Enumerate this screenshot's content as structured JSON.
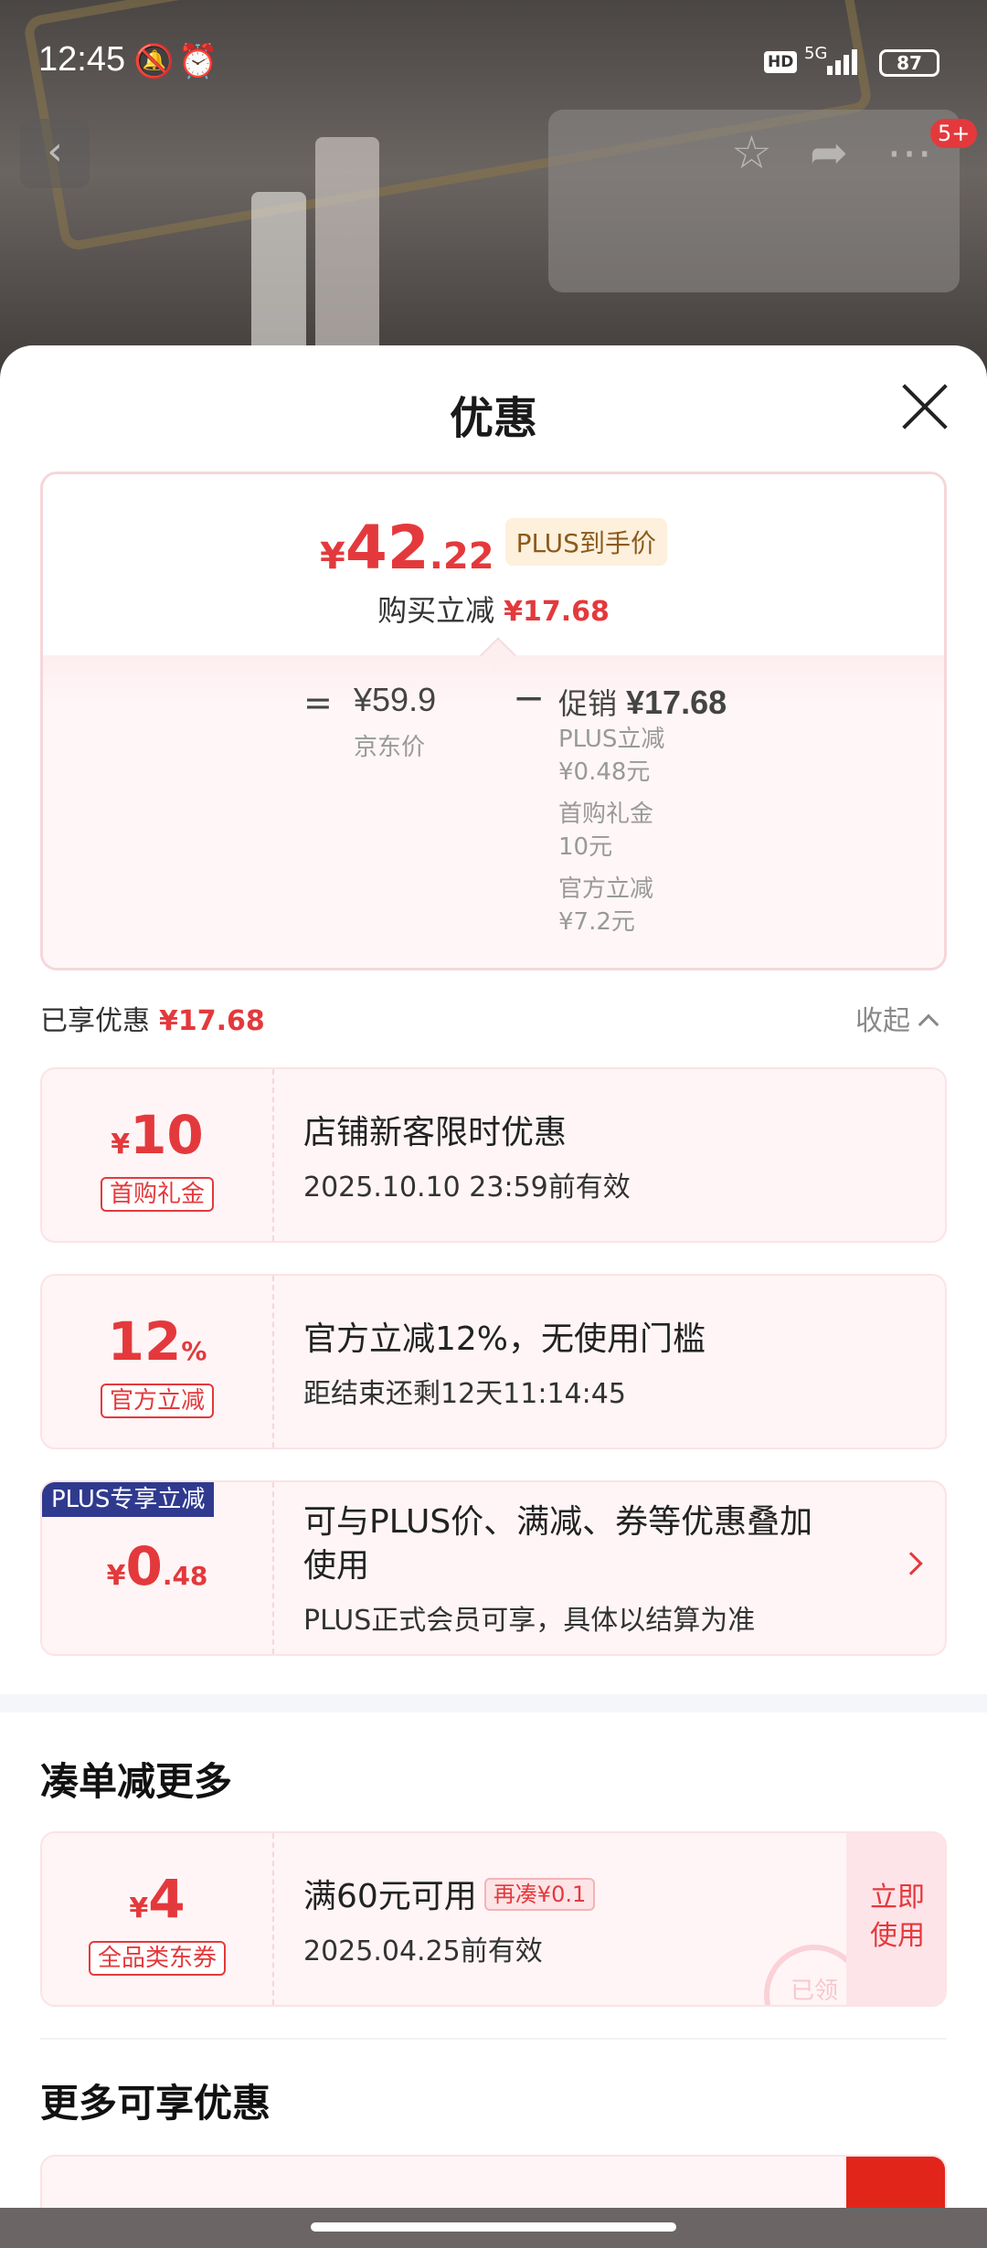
{
  "status_bar": {
    "time": "12:45",
    "network": "5G",
    "hd": "HD",
    "battery": "87"
  },
  "nav": {
    "cart_badge": "5+"
  },
  "sheet": {
    "title": "优惠",
    "summary": {
      "currency": "¥",
      "price_int": "42",
      "price_dec": ".22",
      "price_tag": "PLUS到手价",
      "reduce_label": "购买立减",
      "reduce_value": "¥17.68",
      "equals": "=",
      "jd_price": "¥59.9",
      "jd_label": "京东价",
      "minus": "−",
      "promo_label": "促销",
      "promo_value": "¥17.68",
      "promo_items": [
        {
          "name": "PLUS立减",
          "value": "¥0.48元"
        },
        {
          "name": "首购礼金",
          "value": "10元"
        },
        {
          "name": "官方立减",
          "value": "¥7.2元"
        }
      ]
    },
    "enjoyed": {
      "label": "已享优惠",
      "value": "¥17.68",
      "collapse": "收起"
    },
    "coupons": [
      {
        "sym": "¥",
        "num": "10",
        "dec": "",
        "kind": "首购礼金",
        "title": "店铺新客限时优惠",
        "sub": "2025.10.10 23:59前有效"
      },
      {
        "sym": "",
        "num": "12",
        "dec": "%",
        "kind": "官方立减",
        "title": "官方立减12%，无使用门槛",
        "sub": "距结束还剩12天11:14:45"
      },
      {
        "ribbon": "PLUS专享立减",
        "sym": "¥",
        "num": "0",
        "dec": ".48",
        "title_line1": "可与PLUS价、满减、券等优惠叠加",
        "title_line2": "使用",
        "sub": "PLUS正式会员可享，具体以结算为准"
      }
    ],
    "combine": {
      "title": "凑单减更多",
      "coupon": {
        "sym": "¥",
        "num": "4",
        "kind": "全品类东券",
        "title": "满60元可用",
        "again": "再凑¥0.1",
        "sub": "2025.04.25前有效",
        "action_line1": "立即",
        "action_line2": "使用",
        "stamp": "已领"
      }
    },
    "more": {
      "title": "更多可享优惠"
    }
  }
}
